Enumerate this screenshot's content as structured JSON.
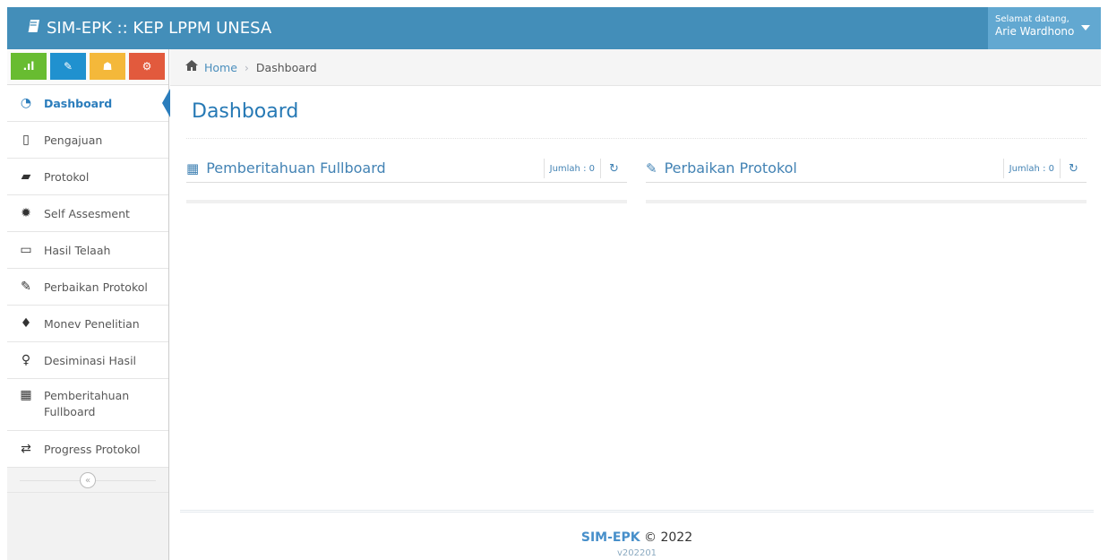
{
  "navbar": {
    "brand": "SIM-EPK :: KEP LPPM UNESA",
    "greeting": "Selamat datang,",
    "user_name": "Arie Wardhono"
  },
  "shortcuts": [
    {
      "icon": "signal-icon",
      "glyph": ".ıl",
      "color": "#68bc31"
    },
    {
      "icon": "pencil-icon",
      "glyph": "✎",
      "color": "#2091cf"
    },
    {
      "icon": "users-icon",
      "glyph": "☗",
      "color": "#f4b83a"
    },
    {
      "icon": "cogs-icon",
      "glyph": "⚙",
      "color": "#e25a3d"
    }
  ],
  "sidebar": {
    "items": [
      {
        "label": "Dashboard",
        "icon": "tachometer-icon",
        "glyph": "◔",
        "active": true
      },
      {
        "label": "Pengajuan",
        "icon": "file-icon",
        "glyph": "▯"
      },
      {
        "label": "Protokol",
        "icon": "book-icon",
        "glyph": "▰"
      },
      {
        "label": "Self Assesment",
        "icon": "certificate-icon",
        "glyph": "✹"
      },
      {
        "label": "Hasil Telaah",
        "icon": "desktop-icon",
        "glyph": "▭"
      },
      {
        "label": "Perbaikan Protokol",
        "icon": "edit-icon",
        "glyph": "✎"
      },
      {
        "label": "Monev Penelitian",
        "icon": "fire-icon",
        "glyph": "♦"
      },
      {
        "label": "Desiminasi Hasil",
        "icon": "lightbulb-icon",
        "glyph": "♀"
      },
      {
        "label": "Pemberitahuan Fullboard",
        "icon": "th-icon",
        "glyph": "▦"
      },
      {
        "label": "Progress Protokol",
        "icon": "exchange-icon",
        "glyph": "⇄"
      }
    ],
    "collapse_glyph": "«"
  },
  "breadcrumb": {
    "home": "Home",
    "separator": "›",
    "current": "Dashboard"
  },
  "page": {
    "title": "Dashboard"
  },
  "widgets": [
    {
      "title": "Pemberitahuan Fullboard",
      "icon": "th-icon",
      "glyph": "▦",
      "count_label": "Jumlah : 0"
    },
    {
      "title": "Perbaikan Protokol",
      "icon": "edit-icon",
      "glyph": "✎",
      "count_label": "Jumlah : 0"
    }
  ],
  "refresh_glyph": "↻",
  "footer": {
    "brand": "SIM-EPK",
    "copyright": "© 2022",
    "version": "v202201"
  }
}
